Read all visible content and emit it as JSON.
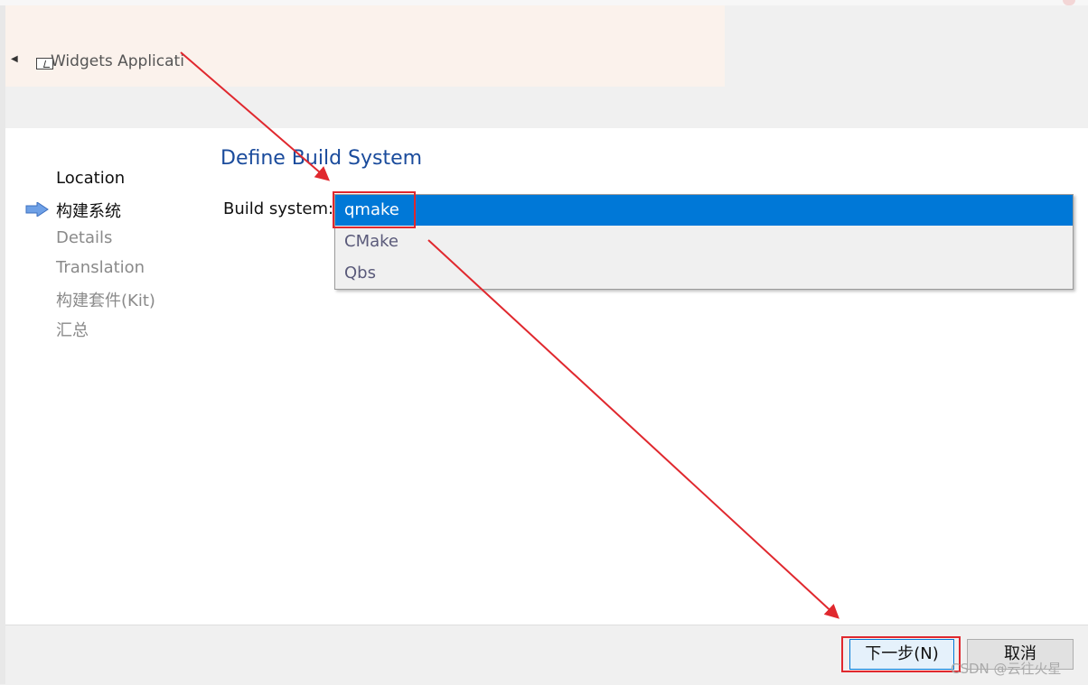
{
  "header": {
    "title": "Widgets Applicati"
  },
  "wizard": {
    "steps": [
      {
        "label": "Location",
        "state": "done"
      },
      {
        "label": "构建系统",
        "state": "current"
      },
      {
        "label": "Details",
        "state": "pending"
      },
      {
        "label": "Translation",
        "state": "pending"
      },
      {
        "label": "构建套件(Kit)",
        "state": "pending"
      },
      {
        "label": "汇总",
        "state": "pending"
      }
    ]
  },
  "main": {
    "section_title": "Define Build System",
    "build_system_label": "Build system:",
    "options": [
      "qmake",
      "CMake",
      "Qbs"
    ],
    "selected": "qmake"
  },
  "footer": {
    "next_label": "下一步(N)",
    "cancel_label": "取消",
    "watermark": "CSDN @云往火星"
  },
  "colors": {
    "accent": "#0078d7",
    "title_blue": "#1a4b9c",
    "annotation_red": "#e0282e",
    "header_bg": "#fbf2ec"
  },
  "icons": {
    "back": "back-arrow-icon",
    "widget": "widgets-window-icon",
    "current_step": "current-step-arrow-icon"
  }
}
